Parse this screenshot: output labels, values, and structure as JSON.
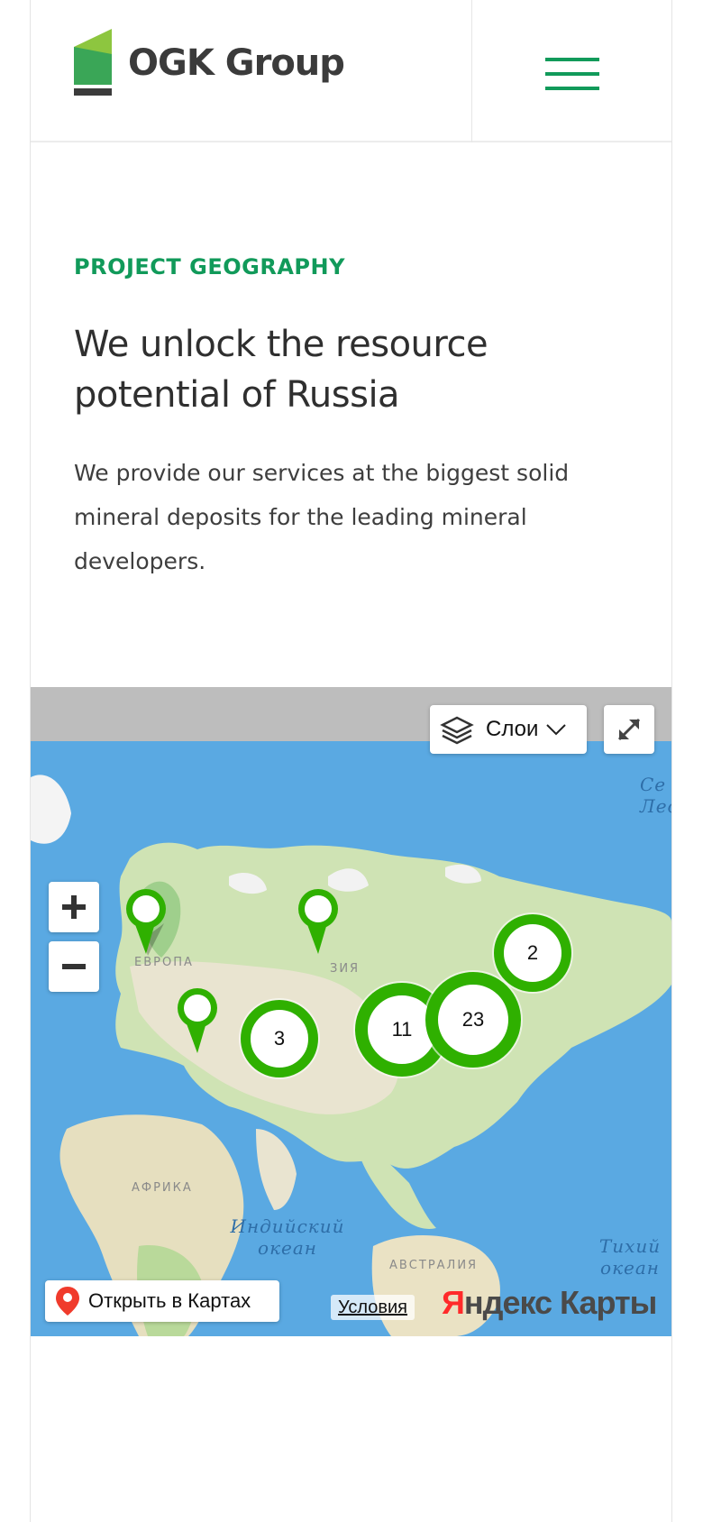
{
  "header": {
    "logo_text": "OGK Group",
    "brand_color": "#119a5a",
    "menu_icon": "hamburger-menu-icon"
  },
  "hero": {
    "eyebrow": "PROJECT GEOGRAPHY",
    "title": "We unlock the resource potential of Russia",
    "lead": "We provide our services at the biggest solid mineral deposits for the leading mineral developers."
  },
  "map": {
    "layers_label": "Слои",
    "zoom_in_label": "+",
    "zoom_out_label": "−",
    "region_labels": {
      "europe": "ЕВРОПА",
      "asia": "ЗИЯ",
      "africa": "АФРИКА",
      "australia": "АВСТРАЛИЯ"
    },
    "ocean_labels": {
      "indian_1": "Индийский",
      "indian_2": "океан",
      "pacific_1": "Тихий",
      "pacific_2": "океан",
      "north_1": "Се",
      "north_2": "Лед"
    },
    "clusters": [
      {
        "count": "3"
      },
      {
        "count": "11"
      },
      {
        "count": "23"
      },
      {
        "count": "2"
      }
    ],
    "marker_color": "#2fb000",
    "open_in_maps_label": "Открыть в Картах",
    "terms_label": "Условия",
    "provider_logo_first": "Я",
    "provider_logo_rest": "ндекс Карты"
  }
}
